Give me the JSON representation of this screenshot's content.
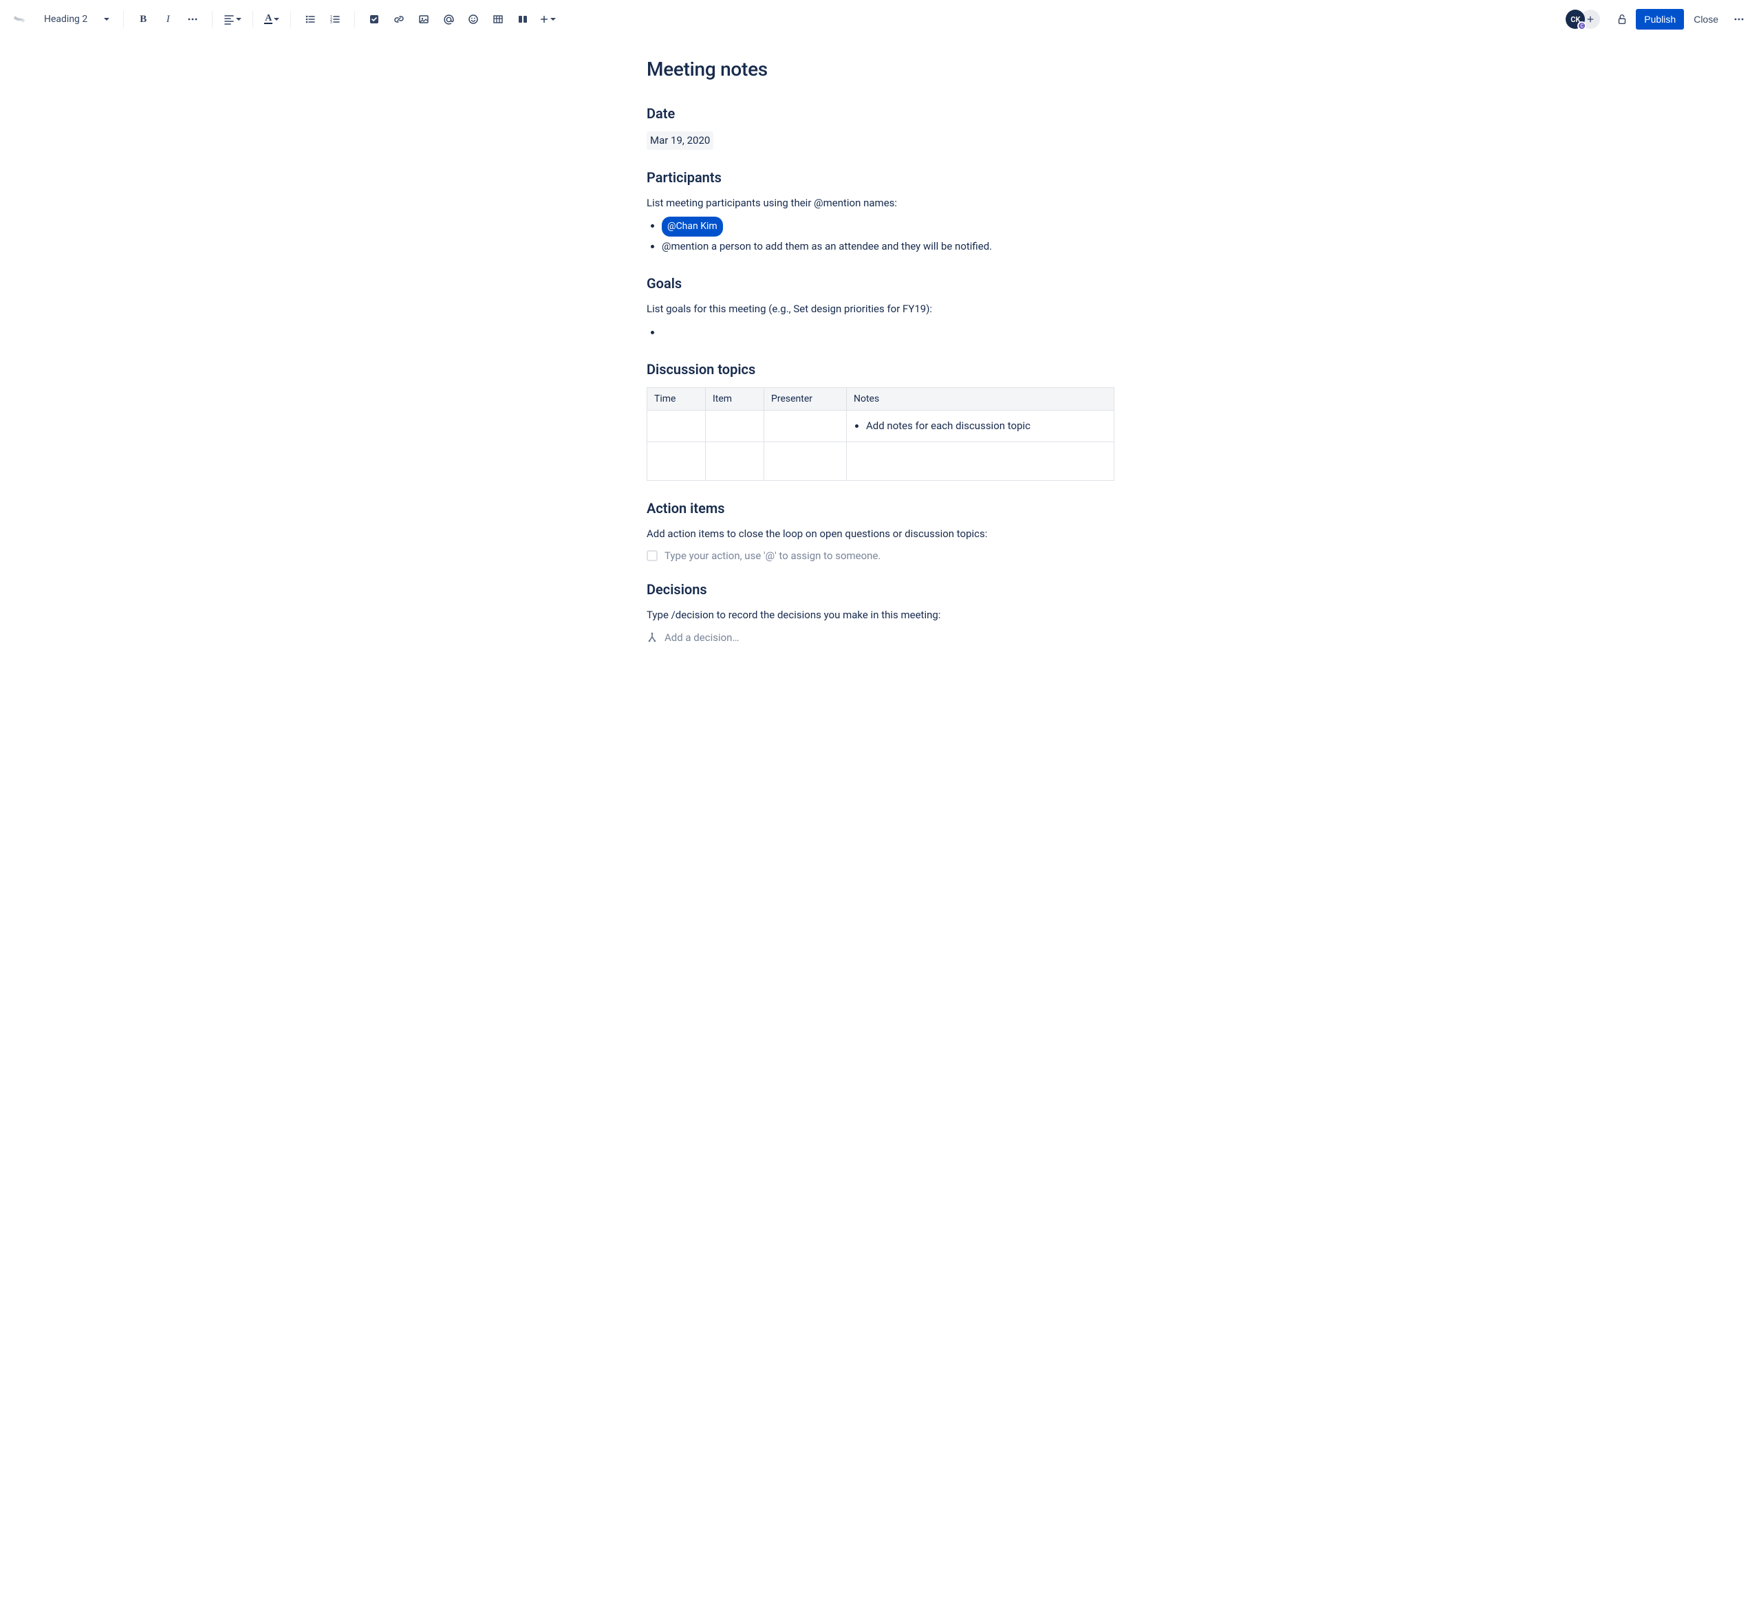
{
  "toolbar": {
    "block_style": "Heading 2",
    "publish_label": "Publish",
    "close_label": "Close"
  },
  "presence": {
    "avatar_initials": "CK",
    "avatar_badge": "C"
  },
  "doc": {
    "title": "Meeting notes",
    "date": {
      "heading": "Date",
      "value": "Mar 19, 2020"
    },
    "participants": {
      "heading": "Participants",
      "intro": "List meeting participants using their @mention names:",
      "mention": "@Chan Kim",
      "hint": "@mention a person to add them as an attendee and they will be notified."
    },
    "goals": {
      "heading": "Goals",
      "intro": "List goals for this meeting (e.g., Set design priorities for FY19):"
    },
    "discussion": {
      "heading": "Discussion topics",
      "columns": {
        "time": "Time",
        "item": "Item",
        "presenter": "Presenter",
        "notes": "Notes"
      },
      "row0_note": "Add notes for each discussion topic"
    },
    "action_items": {
      "heading": "Action items",
      "intro": "Add action items to close the loop on open questions or discussion topics:",
      "placeholder": "Type your action, use '@' to assign to someone."
    },
    "decisions": {
      "heading": "Decisions",
      "intro": "Type /decision to record the decisions you make in this meeting:",
      "placeholder": "Add a decision…"
    }
  }
}
